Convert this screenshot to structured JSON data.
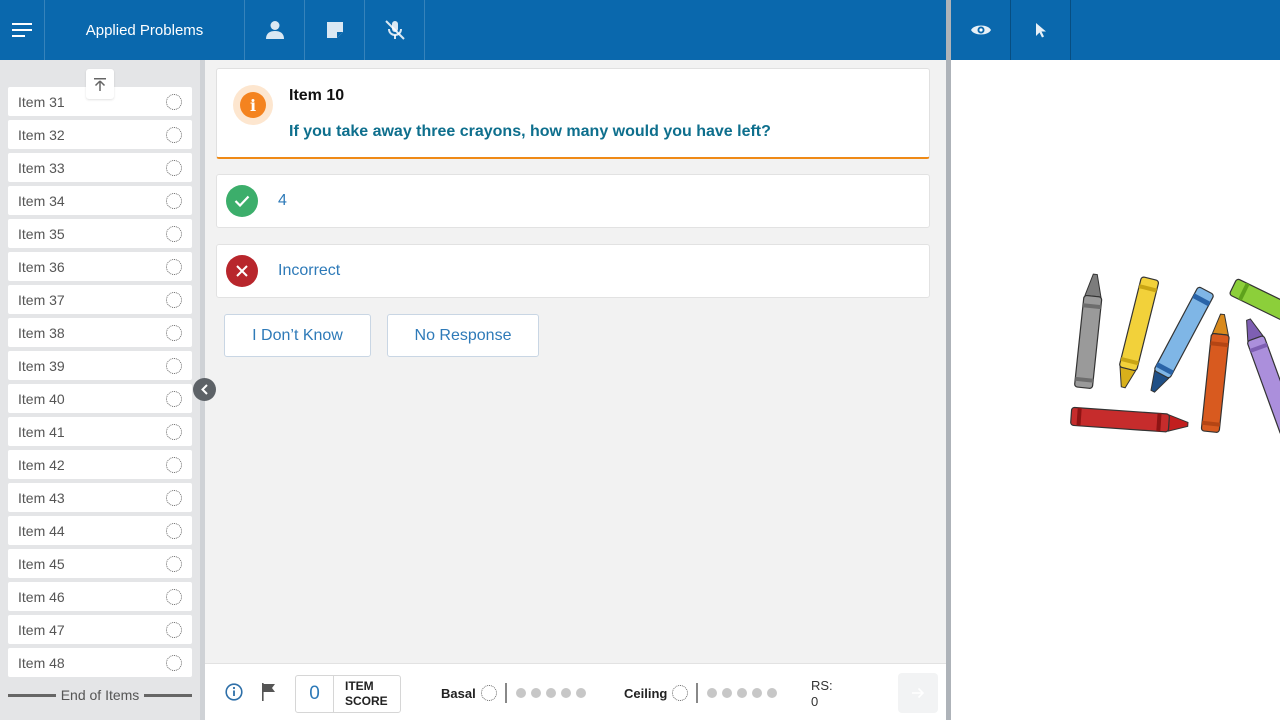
{
  "header": {
    "title": "Applied Problems"
  },
  "sidebar": {
    "items": [
      {
        "label": "Item 31"
      },
      {
        "label": "Item 32"
      },
      {
        "label": "Item 33"
      },
      {
        "label": "Item 34"
      },
      {
        "label": "Item 35"
      },
      {
        "label": "Item 36"
      },
      {
        "label": "Item 37"
      },
      {
        "label": "Item 38"
      },
      {
        "label": "Item 39"
      },
      {
        "label": "Item 40"
      },
      {
        "label": "Item 41"
      },
      {
        "label": "Item 42"
      },
      {
        "label": "Item 43"
      },
      {
        "label": "Item 44"
      },
      {
        "label": "Item 45"
      },
      {
        "label": "Item 46"
      },
      {
        "label": "Item 47"
      },
      {
        "label": "Item 48"
      }
    ],
    "end_label": "End of Items"
  },
  "question": {
    "title": "Item 10",
    "text": "If you take away three crayons, how many would you have left?"
  },
  "answers": {
    "correct_label": "4",
    "incorrect_label": "Incorrect"
  },
  "buttons": {
    "dont_know": "I Don’t Know",
    "no_response": "No Response"
  },
  "footer": {
    "item_score_value": "0",
    "item_score_label_1": "ITEM",
    "item_score_label_2": "SCORE",
    "basal_label": "Basal",
    "ceiling_label": "Ceiling",
    "rs_label": "RS:",
    "rs_value": "0"
  },
  "colors": {
    "header_blue": "#0a68ad",
    "accent_orange": "#f4831f",
    "correct_green": "#3cae6b",
    "incorrect_red": "#b8262c",
    "link_blue": "#2e7ab8"
  },
  "icons": [
    "menu-icon",
    "person-icon",
    "note-icon",
    "mic-off-icon",
    "eye-icon",
    "pointer-icon",
    "scroll-top-icon",
    "chevron-left-icon",
    "info-icon",
    "check-icon",
    "x-icon",
    "flag-icon",
    "arrow-right-icon"
  ]
}
